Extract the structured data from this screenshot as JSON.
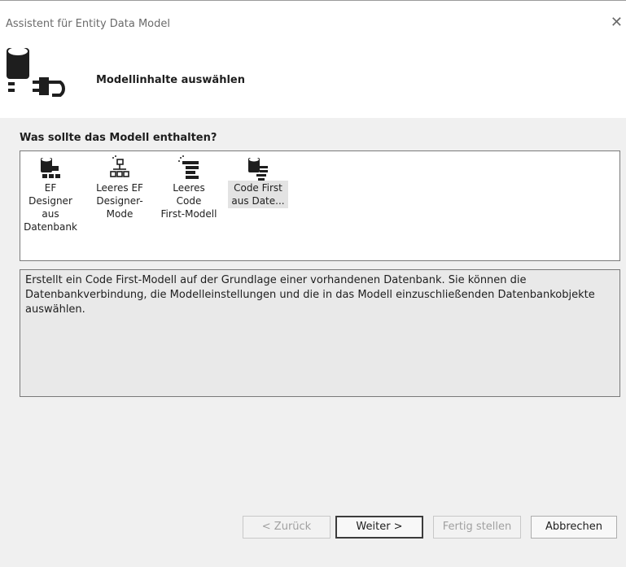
{
  "window": {
    "title": "Assistent für Entity Data Model"
  },
  "header": {
    "title": "Modellinhalte auswählen"
  },
  "question": "Was sollte das Modell enthalten?",
  "choices": [
    {
      "label": "EF Designer\naus\nDatenbank",
      "icon": "database-diagram-icon",
      "selected": false
    },
    {
      "label": "Leeres EF\nDesigner-Mode",
      "icon": "empty-diagram-icon",
      "selected": false
    },
    {
      "label": "Leeres Code\nFirst-Modell",
      "icon": "empty-code-first-icon",
      "selected": false
    },
    {
      "label": "Code First\naus Date...",
      "icon": "database-code-first-icon",
      "selected": true
    }
  ],
  "description": "Erstellt ein Code First-Modell auf der Grundlage einer vorhandenen Datenbank. Sie können die Datenbankverbindung, die Modelleinstellungen und die in das Modell einzuschließenden Datenbankobjekte auswählen.",
  "buttons": {
    "back": "< Zurück",
    "next": "Weiter >",
    "finish": "Fertig stellen",
    "cancel": "Abbrechen"
  }
}
